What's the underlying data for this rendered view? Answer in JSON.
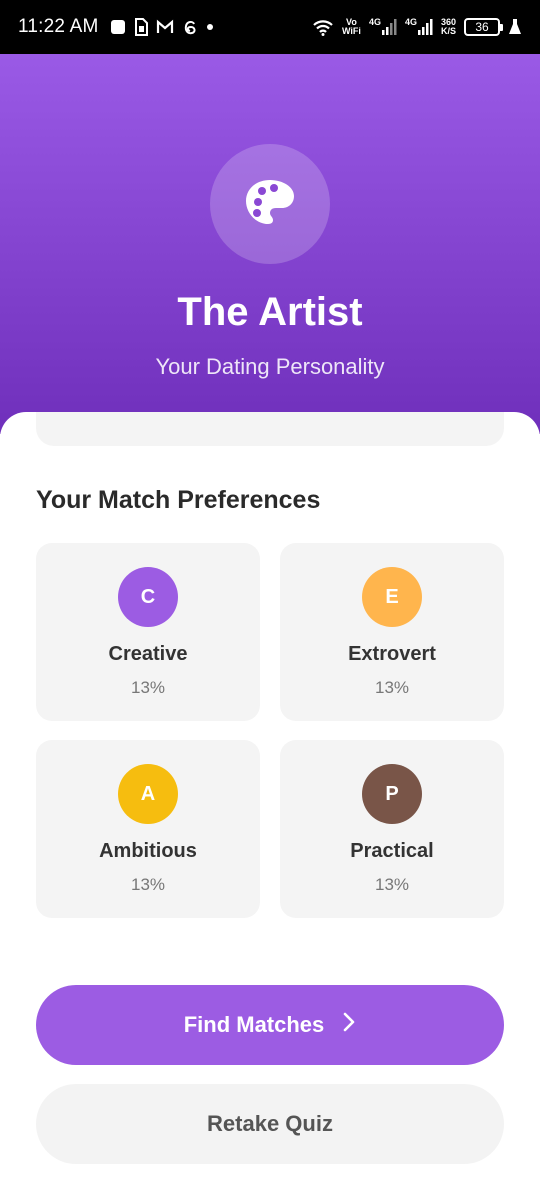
{
  "status_bar": {
    "time": "11:22 AM",
    "left_icons": [
      "notification-square-icon",
      "sim-card-icon",
      "gmail-icon",
      "threads-icon",
      "dot-icon"
    ],
    "wifi_label_top": "Vo",
    "wifi_label_bottom": "WiFi",
    "net1": "4G",
    "net2": "4G",
    "speed_top": "360",
    "speed_bottom": "K/S",
    "battery": "36"
  },
  "header": {
    "icon": "palette-icon",
    "title": "The Artist",
    "subtitle": "Your Dating Personality",
    "gradient_top": "#9a5ae6",
    "gradient_bottom": "#6f2fbb"
  },
  "preferences": {
    "title": "Your Match Preferences",
    "items": [
      {
        "letter": "C",
        "name": "Creative",
        "percent": "13%",
        "color": "#9c5ce3"
      },
      {
        "letter": "E",
        "name": "Extrovert",
        "percent": "13%",
        "color": "#ffb54d"
      },
      {
        "letter": "A",
        "name": "Ambitious",
        "percent": "13%",
        "color": "#f6bd0f"
      },
      {
        "letter": "P",
        "name": "Practical",
        "percent": "13%",
        "color": "#795548"
      }
    ]
  },
  "actions": {
    "find_matches": "Find Matches",
    "find_matches_icon": "chevron-right-icon",
    "retake_quiz": "Retake Quiz",
    "primary_color": "#9c5ce3"
  }
}
